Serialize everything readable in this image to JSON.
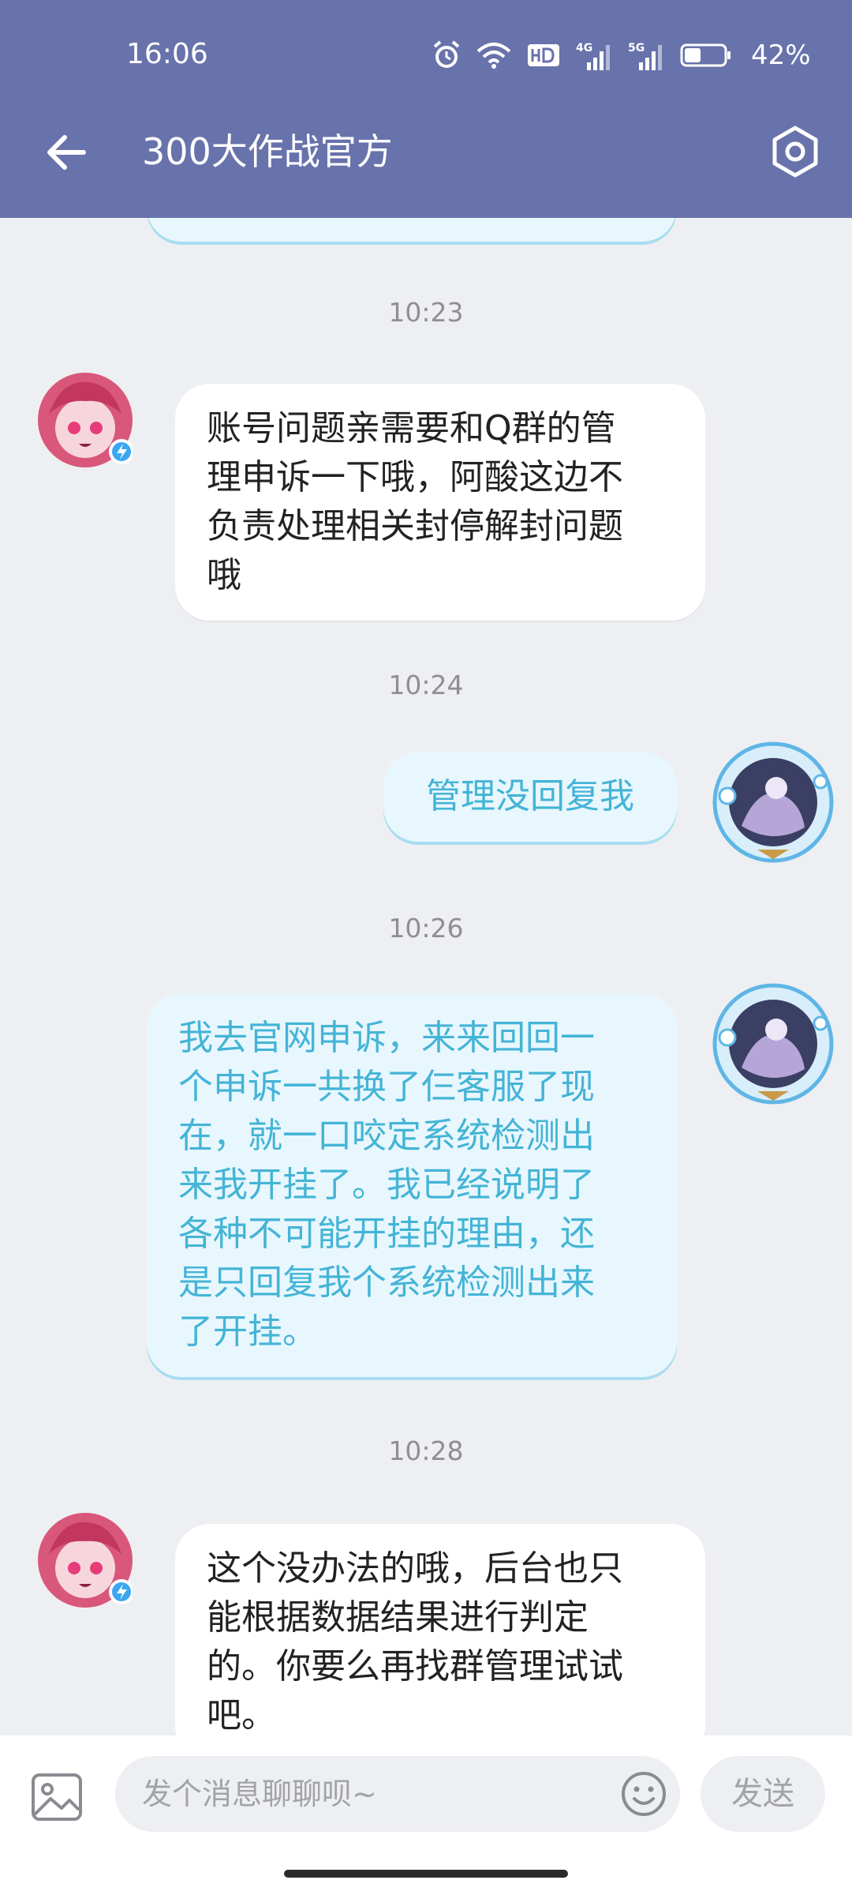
{
  "status_bar": {
    "time": "16:06",
    "net_4g": "4G",
    "net_5g": "5G",
    "battery_percent": "42%",
    "battery_level": 0.42,
    "icons": [
      "alarm-icon",
      "wifi-icon",
      "hd-icon",
      "signal-4g-icon",
      "signal-5g-icon",
      "battery-icon"
    ]
  },
  "header": {
    "title": "300大作战官方",
    "back_icon": "arrow-left-icon",
    "settings_icon": "hexagon-settings-icon"
  },
  "messages": [
    {
      "type": "timestamp",
      "text": "10:23"
    },
    {
      "type": "incoming",
      "lines": [
        "账号问题亲需要和Q群的管",
        "理申诉一下哦，阿酸这边不",
        "负责处理相关封停解封问题",
        "哦"
      ]
    },
    {
      "type": "timestamp",
      "text": "10:24"
    },
    {
      "type": "outgoing",
      "lines": [
        "管理没回复我"
      ]
    },
    {
      "type": "timestamp",
      "text": "10:26"
    },
    {
      "type": "outgoing",
      "lines": [
        "我去官网申诉，来来回回一",
        "个申诉一共换了仨客服了现",
        "在，就一口咬定系统检测出",
        "来我开挂了。我已经说明了",
        "各种不可能开挂的理由，还",
        "是只回复我个系统检测出来",
        "了开挂。"
      ]
    },
    {
      "type": "timestamp",
      "text": "10:28"
    },
    {
      "type": "incoming",
      "lines": [
        "这个没办法的哦，后台也只",
        "能根据数据结果进行判定",
        "的。你要么再找群管理试试",
        "吧。"
      ]
    }
  ],
  "input_bar": {
    "image_icon": "image-icon",
    "placeholder": "发个消息聊聊呗~",
    "emoji_icon": "emoji-icon",
    "send_label": "发送"
  },
  "colors": {
    "header": "#6872ab",
    "background": "#eeeff2",
    "outgoing_text": "#44b4d6",
    "outgoing_bubble": "#e8f7fd",
    "incoming_bubble": "#ffffff"
  }
}
